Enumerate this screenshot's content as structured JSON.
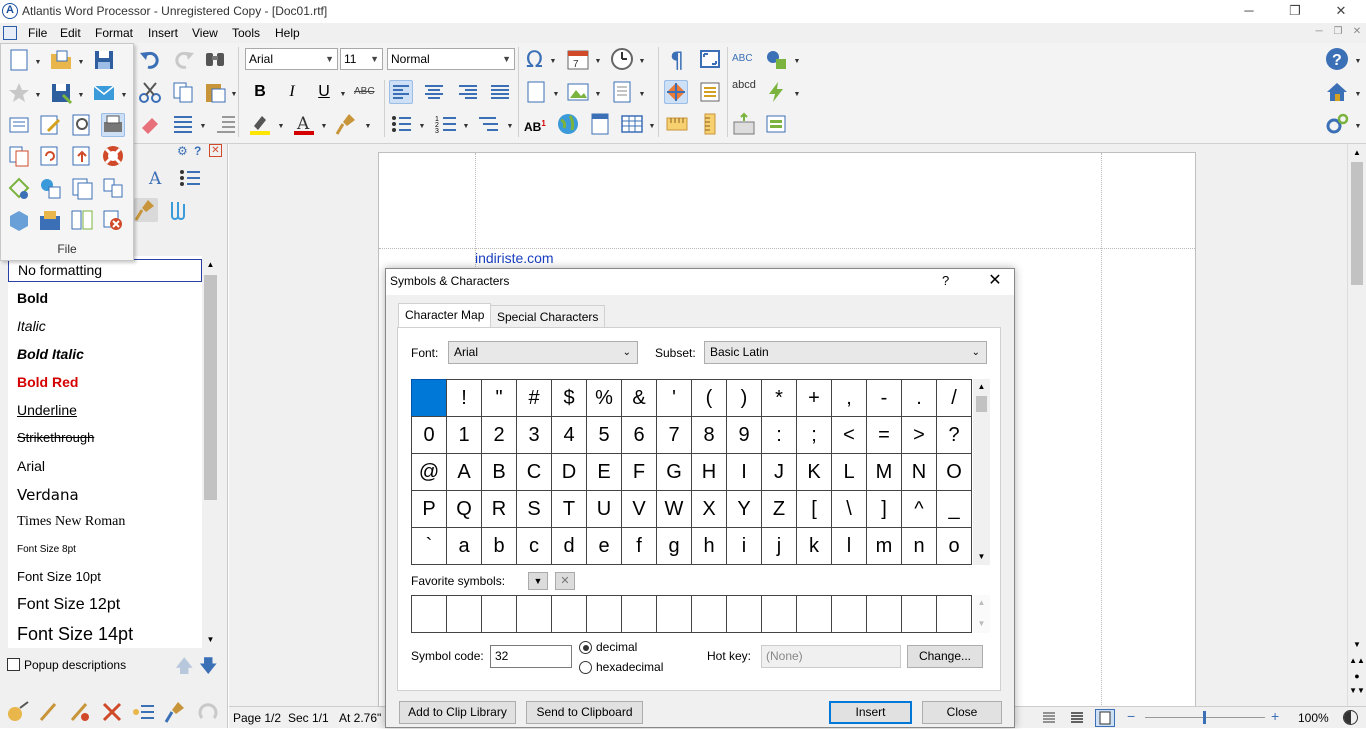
{
  "window": {
    "title": "Atlantis Word Processor - Unregistered Copy - [Doc01.rtf]",
    "logo_letter": "A",
    "minimize": "─",
    "maximize": "❐",
    "close": "✕"
  },
  "menubar": {
    "items": [
      "File",
      "Edit",
      "Format",
      "Insert",
      "View",
      "Tools",
      "Help"
    ]
  },
  "toolbar": {
    "font": "Arial",
    "size": "11",
    "style": "Normal",
    "bold": "B",
    "italic": "I",
    "underline": "U",
    "strike": "ABC",
    "spell": "ABC",
    "abcd": "abcd",
    "ab1": "AB"
  },
  "file_panel": {
    "label": "File"
  },
  "style_list": {
    "items": [
      "No formatting",
      "Bold",
      "Italic",
      "Bold Italic",
      "Bold Red",
      "Underline",
      "Strikethrough",
      "Arial",
      "Verdana",
      "Times New Roman",
      "Font Size 8pt",
      "Font Size 10pt",
      "Font Size 12pt",
      "Font Size 14pt"
    ],
    "popup_descriptions": "Popup descriptions"
  },
  "document": {
    "text": "indiriste.com"
  },
  "statusbar": {
    "page": "Page 1/2",
    "sec": "Sec 1/1",
    "at": "At 2.76\"",
    "zoom": "100%"
  },
  "dialog": {
    "title": "Symbols & Characters",
    "help": "?",
    "close": "✕",
    "tabs": [
      "Character Map",
      "Special Characters"
    ],
    "font_label": "Font:",
    "font_value": "Arial",
    "subset_label": "Subset:",
    "subset_value": "Basic Latin",
    "chars": [
      " ",
      "!",
      "\"",
      "#",
      "$",
      "%",
      "&",
      "'",
      "(",
      ")",
      "*",
      "+",
      ",",
      "-",
      ".",
      "/",
      "0",
      "1",
      "2",
      "3",
      "4",
      "5",
      "6",
      "7",
      "8",
      "9",
      ":",
      ";",
      "<",
      "=",
      ">",
      "?",
      "@",
      "A",
      "B",
      "C",
      "D",
      "E",
      "F",
      "G",
      "H",
      "I",
      "J",
      "K",
      "L",
      "M",
      "N",
      "O",
      "P",
      "Q",
      "R",
      "S",
      "T",
      "U",
      "V",
      "W",
      "X",
      "Y",
      "Z",
      "[",
      "\\",
      "]",
      "^",
      "_",
      "`",
      "a",
      "b",
      "c",
      "d",
      "e",
      "f",
      "g",
      "h",
      "i",
      "j",
      "k",
      "l",
      "m",
      "n",
      "o"
    ],
    "favorites_label": "Favorite symbols:",
    "symbol_code_label": "Symbol code:",
    "symbol_code_value": "32",
    "radio_decimal": "decimal",
    "radio_hex": "hexadecimal",
    "hotkey_label": "Hot key:",
    "hotkey_value": "(None)",
    "change_button": "Change...",
    "add_clip_button": "Add to Clip Library",
    "send_clip_button": "Send to Clipboard",
    "insert_button": "Insert",
    "close_button": "Close"
  },
  "colors": {
    "accent": "#0078d7",
    "link_blue": "#1a3fbf",
    "bold_red": "#d40000"
  }
}
